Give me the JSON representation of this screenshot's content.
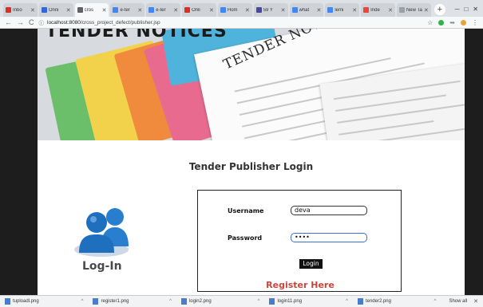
{
  "browser": {
    "tabs": [
      {
        "label": "Inbo",
        "fav_color": "#d93025",
        "active": false
      },
      {
        "label": "Onni",
        "fav_color": "#3367d6",
        "active": false
      },
      {
        "label": "cros",
        "fav_color": "#5f6368",
        "active": true
      },
      {
        "label": "e-ter",
        "fav_color": "#4285f4",
        "active": false
      },
      {
        "label": "e-ter",
        "fav_color": "#4285f4",
        "active": false
      },
      {
        "label": "Onli",
        "fav_color": "#d93025",
        "active": false
      },
      {
        "label": "Hom",
        "fav_color": "#4285f4",
        "active": false
      },
      {
        "label": "59 Y",
        "fav_color": "#4a47a3",
        "active": false
      },
      {
        "label": "what",
        "fav_color": "#4285f4",
        "active": false
      },
      {
        "label": "lemi",
        "fav_color": "#4285f4",
        "active": false
      },
      {
        "label": "Inde",
        "fav_color": "#e8453c",
        "active": false
      },
      {
        "label": "New Tab",
        "fav_color": "#9aa0a6",
        "active": false
      }
    ],
    "url_host": "localhost:8080",
    "url_path": "/cross_project_defect/publisher.jsp"
  },
  "hero": {
    "headline": "TENDER NOTICES",
    "paper_title": "TENDER NOTICE"
  },
  "login": {
    "title": "Tender Publisher Login",
    "caption": "Log-In",
    "username_label": "Username",
    "username_value": "deva",
    "password_label": "Password",
    "password_value": "••••",
    "login_button": "Login",
    "register_link": "Register Here"
  },
  "downloads": {
    "items": [
      "tuploadl.png",
      "register1.png",
      "login2.png",
      "login11.png",
      "tender2.png"
    ],
    "show_all": "Show all"
  },
  "colors": {
    "register_red": "#c8453e",
    "icon_blue": "#1f6fbf"
  }
}
